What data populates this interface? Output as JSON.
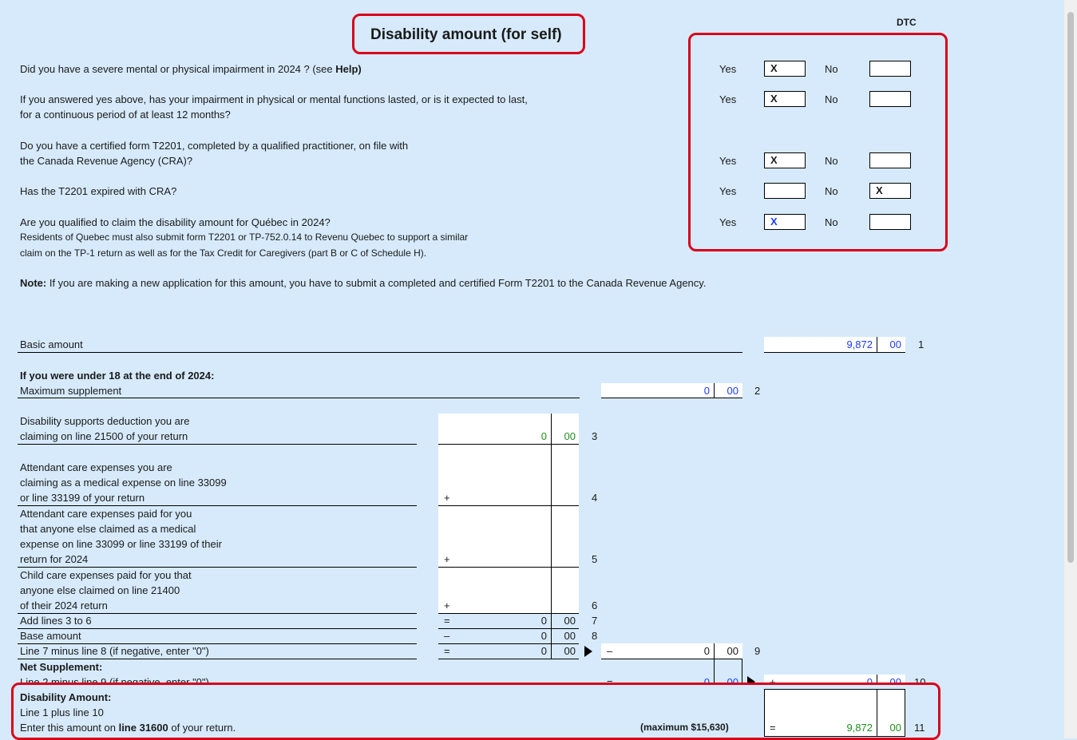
{
  "header": {
    "title": "Disability amount (for self)",
    "code": "DTC"
  },
  "questions": [
    {
      "lines": [
        "Did you have a severe mental or physical impairment in 2024 ? (see "
      ],
      "bold_tail": "Help)",
      "yes_label": "Yes",
      "yes_value": "X",
      "no_label": "No",
      "no_value": ""
    },
    {
      "lines": [
        "If you answered yes above, has your impairment in physical or mental functions lasted, or is it expected to last,",
        "for a continuous period of at least 12 months?"
      ],
      "yes_label": "Yes",
      "yes_value": "X",
      "no_label": "No",
      "no_value": ""
    },
    {
      "lines": [
        "Do you have a certified form T2201, completed by a qualified practitioner, on file with",
        "the Canada Revenue Agency (CRA)?"
      ],
      "yes_label": "Yes",
      "yes_value": "X",
      "no_label": "No",
      "no_value": ""
    },
    {
      "lines": [
        "Has the T2201 expired with CRA?"
      ],
      "yes_label": "Yes",
      "yes_value": "",
      "no_label": "No",
      "no_value": "X"
    },
    {
      "lines": [
        "Are you qualified to claim the disability amount for Québec in 2024?",
        "Residents of Quebec must also submit form T2201 or TP-752.0.14 to Revenu Quebec to support a similar",
        "claim on the TP-1 return as well as for the Tax Credit for Caregivers (part B or C of Schedule H)."
      ],
      "yes_label": "Yes",
      "yes_value": "X",
      "no_label": "No",
      "no_value": ""
    }
  ],
  "note": {
    "label": "Note:",
    "text": " If you are making a new application for this amount, you have to submit a completed and certified Form T2201 to the Canada Revenue Agency."
  },
  "lines": {
    "basic_amount": {
      "label": "Basic amount",
      "dollars": "9,872",
      "cents": "00",
      "num": "1"
    },
    "under18_heading": "If you were under 18 at the end of 2024:",
    "max_supplement": {
      "label": "Maximum supplement",
      "dollars": "0",
      "cents": "00",
      "num": "2"
    },
    "line3": {
      "label1": "Disability supports deduction you are",
      "label2": "claiming on line 21500 of your return",
      "dollars": "0",
      "cents": "00",
      "num": "3"
    },
    "line4": {
      "label1": "Attendant care expenses you are",
      "label2": "claiming as a medical expense on line 33099",
      "label3": "or line 33199 of your return",
      "op": "+",
      "num": "4"
    },
    "line5": {
      "label1": "Attendant care expenses paid for you",
      "label2": "that anyone else claimed as a medical",
      "label3": "expense on line 33099 or line 33199 of their",
      "label4": "return for 2024",
      "op": "+",
      "num": "5"
    },
    "line6": {
      "label1": "Child care expenses paid for you that",
      "label2": "anyone else claimed on line 21400",
      "label3": "of their 2024 return",
      "op": "+",
      "num": "6"
    },
    "line7": {
      "label": "Add lines 3 to 6",
      "op": "=",
      "dollars": "0",
      "cents": "00",
      "num": "7"
    },
    "line8": {
      "label": "Base amount",
      "op": "–",
      "dollars": "0",
      "cents": "00",
      "num": "8"
    },
    "line9": {
      "label": "Line 7 minus line 8 (if negative, enter \"0\")",
      "op": "=",
      "dollars": "0",
      "cents": "00",
      "op2": "–",
      "dollars2": "0",
      "cents2": "00",
      "num": "9"
    },
    "net_supplement_heading": "Net Supplement:",
    "line10": {
      "label": "Line 2 minus line 9 (if negative, enter \"0\")",
      "op": "=",
      "dollars": "0",
      "cents": "00",
      "op2": "+",
      "dollars2": "0",
      "cents2": "00",
      "num": "10"
    },
    "disability_heading": "Disability Amount:",
    "line11": {
      "label1": "Line 1 plus line 10",
      "label2_pre": "Enter this amount on ",
      "label2_bold": "line 31600",
      "label2_post": " of your return.",
      "max_note": "(maximum $15,630)",
      "op": "=",
      "dollars": "9,872",
      "cents": "00",
      "num": "11"
    }
  },
  "colors": {
    "background": "#d6eafb",
    "highlight": "#d9001b",
    "entered": "#1e3cff",
    "calculated": "#1f8f1f"
  }
}
